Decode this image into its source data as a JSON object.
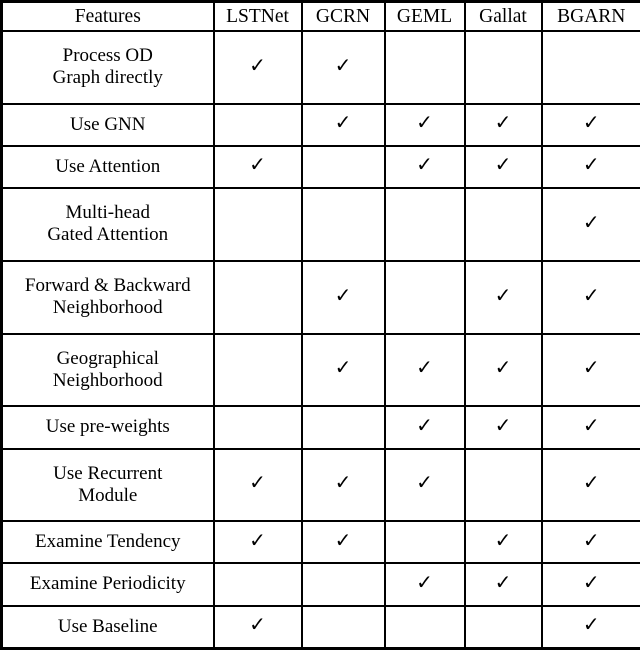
{
  "table": {
    "check_glyph": "✓",
    "columns": [
      {
        "key": "feature",
        "label": "Features",
        "bold": false
      },
      {
        "key": "lstnet",
        "label": "LSTNet",
        "bold": false
      },
      {
        "key": "gcrn",
        "label": "GCRN",
        "bold": false
      },
      {
        "key": "geml",
        "label": "GEML",
        "bold": false
      },
      {
        "key": "gallat",
        "label": "Gallat",
        "bold": false
      },
      {
        "key": "bgarn",
        "label": "BGARN",
        "bold": true
      }
    ],
    "rows": [
      {
        "feature_lines": [
          "Process OD",
          "Graph directly"
        ],
        "feature": "Process OD Graph directly",
        "line1": "Process OD",
        "line2": "Graph directly",
        "lstnet": "✓",
        "gcrn": "✓",
        "geml": "",
        "gallat": "",
        "bgarn": ""
      },
      {
        "feature_lines": [
          "Use GNN"
        ],
        "feature": "Use GNN",
        "line1": "Use GNN",
        "line2": "",
        "lstnet": "",
        "gcrn": "✓",
        "geml": "✓",
        "gallat": "✓",
        "bgarn": "✓"
      },
      {
        "feature_lines": [
          "Use Attention"
        ],
        "feature": "Use Attention",
        "line1": "Use Attention",
        "line2": "",
        "lstnet": "✓",
        "gcrn": "",
        "geml": "✓",
        "gallat": "✓",
        "bgarn": "✓"
      },
      {
        "feature_lines": [
          "Multi-head",
          "Gated Attention"
        ],
        "feature": "Multi-head Gated Attention",
        "line1": "Multi-head",
        "line2": "Gated Attention",
        "lstnet": "",
        "gcrn": "",
        "geml": "",
        "gallat": "",
        "bgarn": "✓"
      },
      {
        "feature_lines": [
          "Forward & Backward",
          "Neighborhood"
        ],
        "feature": "Forward & Backward Neighborhood",
        "line1": "Forward & Backward",
        "line2": "Neighborhood",
        "lstnet": "",
        "gcrn": "✓",
        "geml": "",
        "gallat": "✓",
        "bgarn": "✓"
      },
      {
        "feature_lines": [
          "Geographical",
          "Neighborhood"
        ],
        "feature": "Geographical Neighborhood",
        "line1": "Geographical",
        "line2": "Neighborhood",
        "lstnet": "",
        "gcrn": "✓",
        "geml": "✓",
        "gallat": "✓",
        "bgarn": "✓"
      },
      {
        "feature_lines": [
          "Use pre-weights"
        ],
        "feature": "Use pre-weights",
        "line1": "Use pre-weights",
        "line2": "",
        "lstnet": "",
        "gcrn": "",
        "geml": "✓",
        "gallat": "✓",
        "bgarn": "✓"
      },
      {
        "feature_lines": [
          "Use Recurrent",
          "Module"
        ],
        "feature": "Use Recurrent Module",
        "line1": "Use Recurrent",
        "line2": "Module",
        "lstnet": "✓",
        "gcrn": "✓",
        "geml": "✓",
        "gallat": "",
        "bgarn": "✓"
      },
      {
        "feature_lines": [
          "Examine Tendency"
        ],
        "feature": "Examine Tendency",
        "line1": "Examine Tendency",
        "line2": "",
        "lstnet": "✓",
        "gcrn": "✓",
        "geml": "",
        "gallat": "✓",
        "bgarn": "✓"
      },
      {
        "feature_lines": [
          "Examine Periodicity"
        ],
        "feature": "Examine Periodicity",
        "line1": "Examine Periodicity",
        "line2": "",
        "lstnet": "",
        "gcrn": "",
        "geml": "✓",
        "gallat": "✓",
        "bgarn": "✓"
      },
      {
        "feature_lines": [
          "Use Baseline"
        ],
        "feature": "Use Baseline",
        "line1": "Use Baseline",
        "line2": "",
        "lstnet": "✓",
        "gcrn": "",
        "geml": "",
        "gallat": "",
        "bgarn": "✓"
      }
    ]
  },
  "colors": {
    "border": "#000000",
    "background": "#ffffff",
    "text": "#000000"
  }
}
